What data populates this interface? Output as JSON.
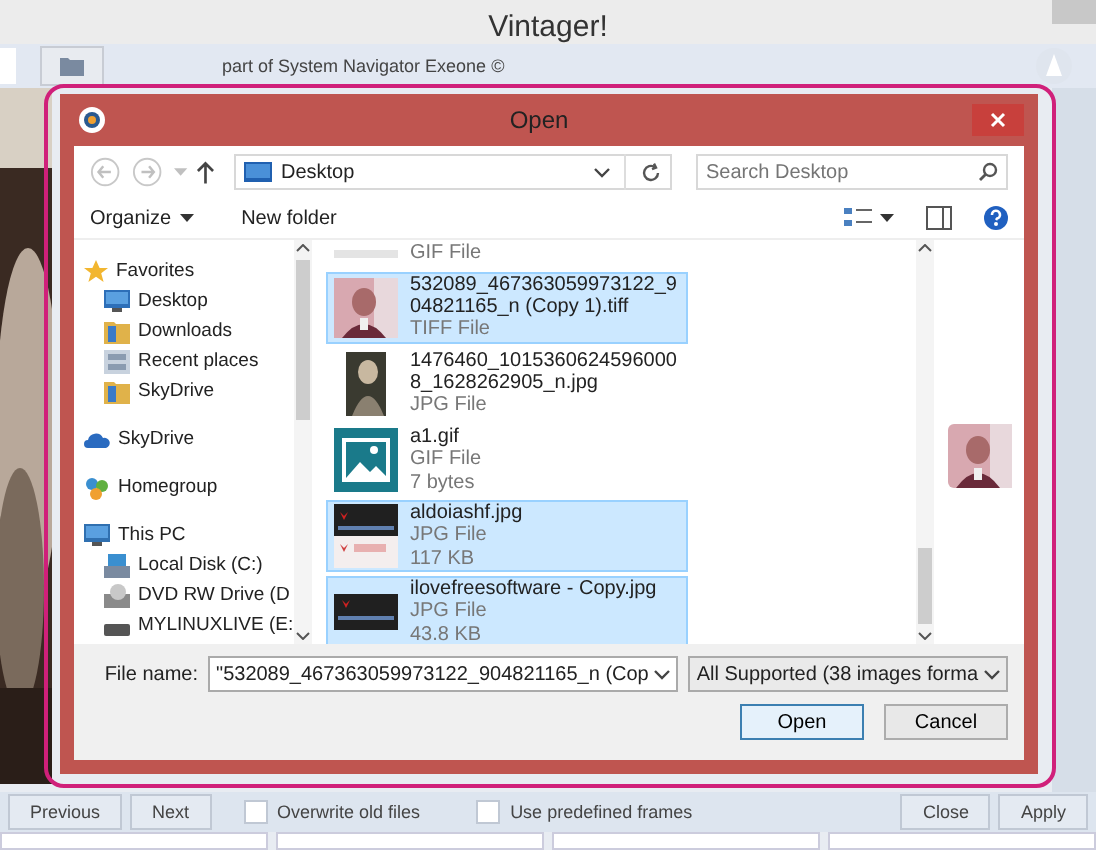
{
  "window": {
    "title": "Vintager!"
  },
  "toolbar": {
    "caption": "part of System Navigator Exeone ©"
  },
  "dialog": {
    "title": "Open",
    "address": "Desktop",
    "search": {
      "placeholder": "Search Desktop"
    },
    "organize": "Organize",
    "new_folder": "New folder",
    "nav_tree": [
      {
        "label": "Favorites",
        "kind": "star",
        "children": [
          {
            "label": "Desktop",
            "kind": "desktop"
          },
          {
            "label": "Downloads",
            "kind": "folder"
          },
          {
            "label": "Recent places",
            "kind": "recent"
          },
          {
            "label": "SkyDrive",
            "kind": "folder"
          }
        ]
      },
      {
        "label": "SkyDrive",
        "kind": "cloud"
      },
      {
        "label": "Homegroup",
        "kind": "homegroup"
      },
      {
        "label": "This PC",
        "kind": "pc",
        "children": [
          {
            "label": "Local Disk (C:)",
            "kind": "disk"
          },
          {
            "label": "DVD RW Drive (D",
            "kind": "dvd"
          },
          {
            "label": "MYLINUXLIVE (E:",
            "kind": "usb"
          }
        ]
      }
    ],
    "files": [
      {
        "details": [
          "GIF File"
        ],
        "kind": "none",
        "selected": false
      },
      {
        "name": "532089_467363059973122_904821165_n (Copy 1).tiff",
        "details": [
          "TIFF File"
        ],
        "selected": true
      },
      {
        "name": "1476460_10153606245960008_1628262905_n.jpg",
        "details": [
          "JPG File"
        ],
        "kind": "portrait",
        "selected": false
      },
      {
        "name": "a1.gif",
        "details": [
          "GIF File",
          "7 bytes"
        ],
        "kind": "icon",
        "selected": false
      },
      {
        "name": "aldoiashf.jpg",
        "details": [
          "JPG File",
          "117 KB"
        ],
        "kind": "double",
        "selected": true
      },
      {
        "name": "ilovefreesoftware - Copy.jpg",
        "details": [
          "JPG File",
          "43.8 KB"
        ],
        "kind": "banner",
        "selected": true
      }
    ],
    "preview": {
      "kind": "picture"
    },
    "file_name_label": "File name:",
    "file_name": "\"532089_467363059973122_904821165_n (Cop",
    "filter": "All Supported (38 images forma",
    "buttons": [
      "Open",
      "Cancel"
    ]
  },
  "bottom_bar": [
    {
      "kind": "button",
      "label": "Previous"
    },
    {
      "kind": "button",
      "label": "Next"
    },
    {
      "kind": "checkbox",
      "label": "Overwrite old files",
      "checked": false
    },
    {
      "kind": "checkbox",
      "label": "Use predefined frames",
      "checked": false
    },
    {
      "kind": "button",
      "label": "Close"
    },
    {
      "kind": "button",
      "label": "Apply"
    }
  ]
}
